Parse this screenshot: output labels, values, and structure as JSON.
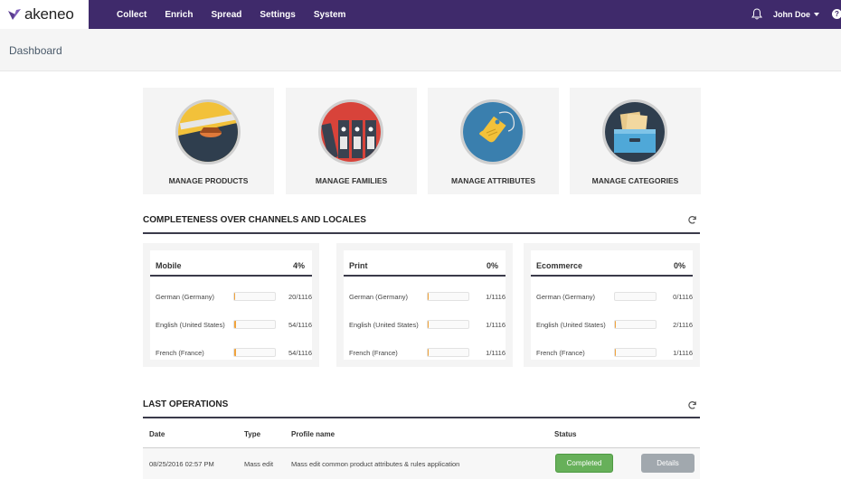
{
  "app": {
    "logo_text": "akeneo"
  },
  "nav": {
    "items": [
      "Collect",
      "Enrich",
      "Spread",
      "Settings",
      "System"
    ]
  },
  "user": {
    "name": "John Doe",
    "help": "?"
  },
  "breadcrumb": {
    "title": "Dashboard"
  },
  "tiles": [
    {
      "label": "MANAGE PRODUCTS",
      "icon": "product-stack-icon"
    },
    {
      "label": "MANAGE FAMILIES",
      "icon": "binders-icon"
    },
    {
      "label": "MANAGE ATTRIBUTES",
      "icon": "price-tag-icon"
    },
    {
      "label": "MANAGE CATEGORIES",
      "icon": "drawer-icon"
    }
  ],
  "completeness": {
    "title": "COMPLETENESS OVER CHANNELS AND LOCALES",
    "channels": [
      {
        "name": "Mobile",
        "percent": "4%",
        "locales": [
          {
            "locale": "German (Germany)",
            "count": "20/1116",
            "ratio": 0.018
          },
          {
            "locale": "English (United States)",
            "count": "54/1116",
            "ratio": 0.048
          },
          {
            "locale": "French (France)",
            "count": "54/1116",
            "ratio": 0.048
          }
        ]
      },
      {
        "name": "Print",
        "percent": "0%",
        "locales": [
          {
            "locale": "German (Germany)",
            "count": "1/1116",
            "ratio": 0.001
          },
          {
            "locale": "English (United States)",
            "count": "1/1116",
            "ratio": 0.001
          },
          {
            "locale": "French (France)",
            "count": "1/1116",
            "ratio": 0.001
          }
        ]
      },
      {
        "name": "Ecommerce",
        "percent": "0%",
        "locales": [
          {
            "locale": "German (Germany)",
            "count": "0/1116",
            "ratio": 0
          },
          {
            "locale": "English (United States)",
            "count": "2/1116",
            "ratio": 0.002
          },
          {
            "locale": "French (France)",
            "count": "1/1116",
            "ratio": 0.001
          }
        ]
      }
    ]
  },
  "operations": {
    "title": "LAST OPERATIONS",
    "headers": {
      "date": "Date",
      "type": "Type",
      "profile": "Profile name",
      "status": "Status"
    },
    "rows": [
      {
        "date": "08/25/2016 02:57 PM",
        "type": "Mass edit",
        "profile": "Mass edit common product attributes & rules application",
        "status": "Completed",
        "action": "Details"
      }
    ]
  },
  "colors": {
    "nav_bg": "#3f2a6b",
    "progress": "#f0a33c",
    "completed": "#67b05a"
  }
}
